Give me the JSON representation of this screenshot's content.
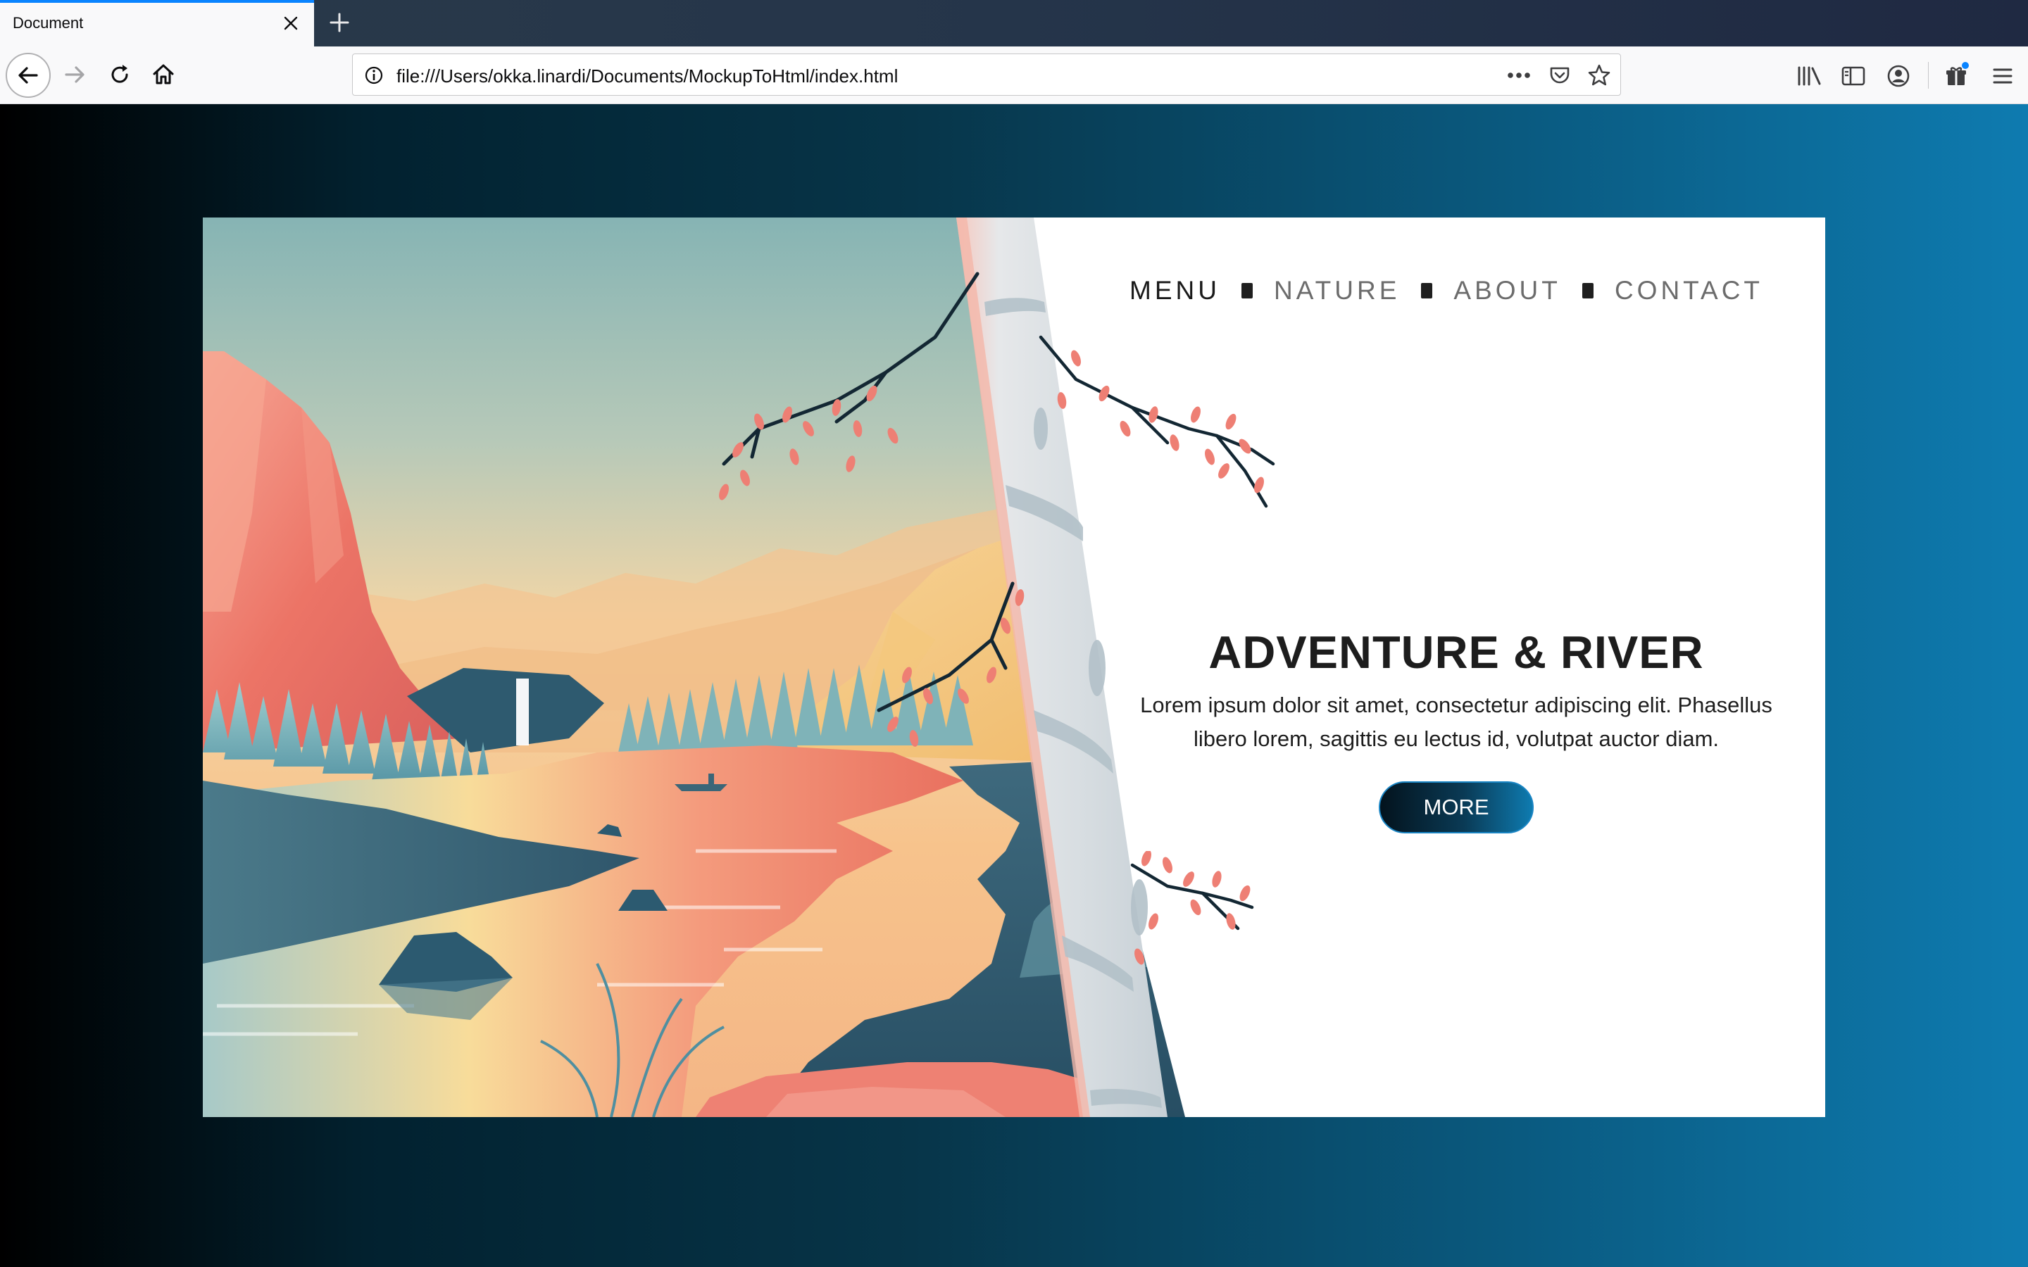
{
  "browser": {
    "tab_title": "Document",
    "url": "file:///Users/okka.linardi/Documents/MockupToHtml/index.html"
  },
  "site": {
    "menu": [
      {
        "label": "MENU",
        "active": true
      },
      {
        "label": "NATURE",
        "active": false
      },
      {
        "label": "ABOUT",
        "active": false
      },
      {
        "label": "CONTACT",
        "active": false
      }
    ],
    "headline": "ADVENTURE & RIVER",
    "lead_line1": "Lorem ipsum dolor sit amet, consectetur adipiscing elit. Phasellus",
    "lead_line2": "libero lorem, sagittis eu lectus id, volutpat auctor diam.",
    "button_label": "MORE"
  },
  "colors": {
    "page_gradient_left": "#000000",
    "page_gradient_right": "#0e7bb0",
    "accent": "#0a84ff"
  },
  "icons": {
    "nav": [
      "back-arrow-icon",
      "forward-arrow-icon",
      "reload-icon",
      "home-icon"
    ],
    "url": [
      "info-icon",
      "more-dots-icon",
      "pocket-icon",
      "bookmark-star-icon"
    ],
    "toolbar": [
      "library-icon",
      "sidebar-icon",
      "account-icon",
      "whats-new-icon",
      "hamburger-menu-icon"
    ]
  }
}
